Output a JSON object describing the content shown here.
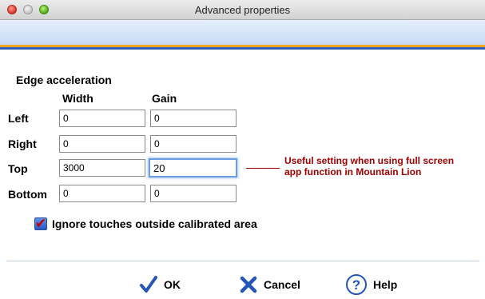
{
  "window": {
    "title": "Advanced properties"
  },
  "section": {
    "title": "Edge acceleration"
  },
  "columns": {
    "width": "Width",
    "gain": "Gain"
  },
  "rows": [
    {
      "label": "Left",
      "width": "0",
      "gain": "0"
    },
    {
      "label": "Right",
      "width": "0",
      "gain": "0"
    },
    {
      "label": "Top",
      "width": "3000",
      "gain": "20"
    },
    {
      "label": "Bottom",
      "width": "0",
      "gain": "0"
    }
  ],
  "annotation": {
    "line1": "Useful setting when using full screen",
    "line2": "app function in Mountain Lion",
    "color": "#a00000"
  },
  "checkbox": {
    "label": "Ignore touches outside calibrated area",
    "checked": true
  },
  "buttons": {
    "ok": "OK",
    "cancel": "Cancel",
    "help": "Help"
  },
  "icons": {
    "ok": "checkmark-icon",
    "cancel": "x-icon",
    "help": "question-icon"
  },
  "colors": {
    "banner_orange": "#f0a622",
    "banner_blue": "#2f5fb8",
    "focus": "#6a9ce0"
  }
}
